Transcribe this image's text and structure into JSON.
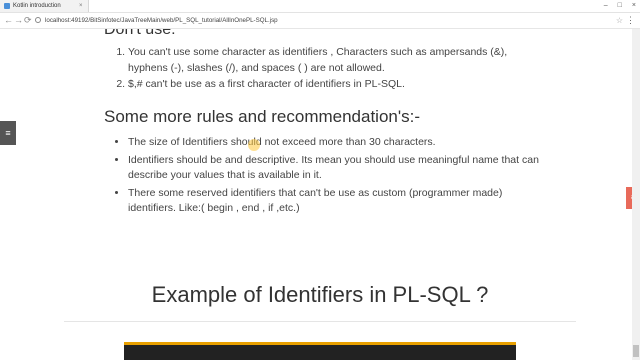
{
  "browser": {
    "tab_title": "Kotlin introduction",
    "tab_close": "×",
    "url": "localhost:49192/BitSinfotec/JavaTreeMain/web/PL_SQL_tutorial/AllInOnePL-SQL.jsp",
    "back": "←",
    "forward": "→",
    "reload": "⟳",
    "star": "☆",
    "menu": "⋮",
    "minimize": "–",
    "maximize": "□",
    "close": "×"
  },
  "content": {
    "cut_heading": "Don't use:",
    "rules": [
      "You can't use some character as identifiers , Characters such as ampersands (&), hyphens (-), slashes (/), and spaces ( ) are not allowed.",
      "$,# can't be use as a first character of identifiers in PL-SQL."
    ],
    "section_heading": "Some more rules and recommendation's:-",
    "recommendations": [
      "The size of Identifiers should not exceed more than 30 characters.",
      "Identifiers should be and descriptive. Its mean you should use meaningful name that can describe your values that is available in it.",
      "There some reserved identifiers that can't be use as custom (programmer made) identifiers. Like:( begin , end , if ,etc.)"
    ],
    "example_heading": "Example of Identifiers in PL-SQL ?",
    "left_tab_icon": "≡",
    "right_tab_icon": "≡"
  }
}
